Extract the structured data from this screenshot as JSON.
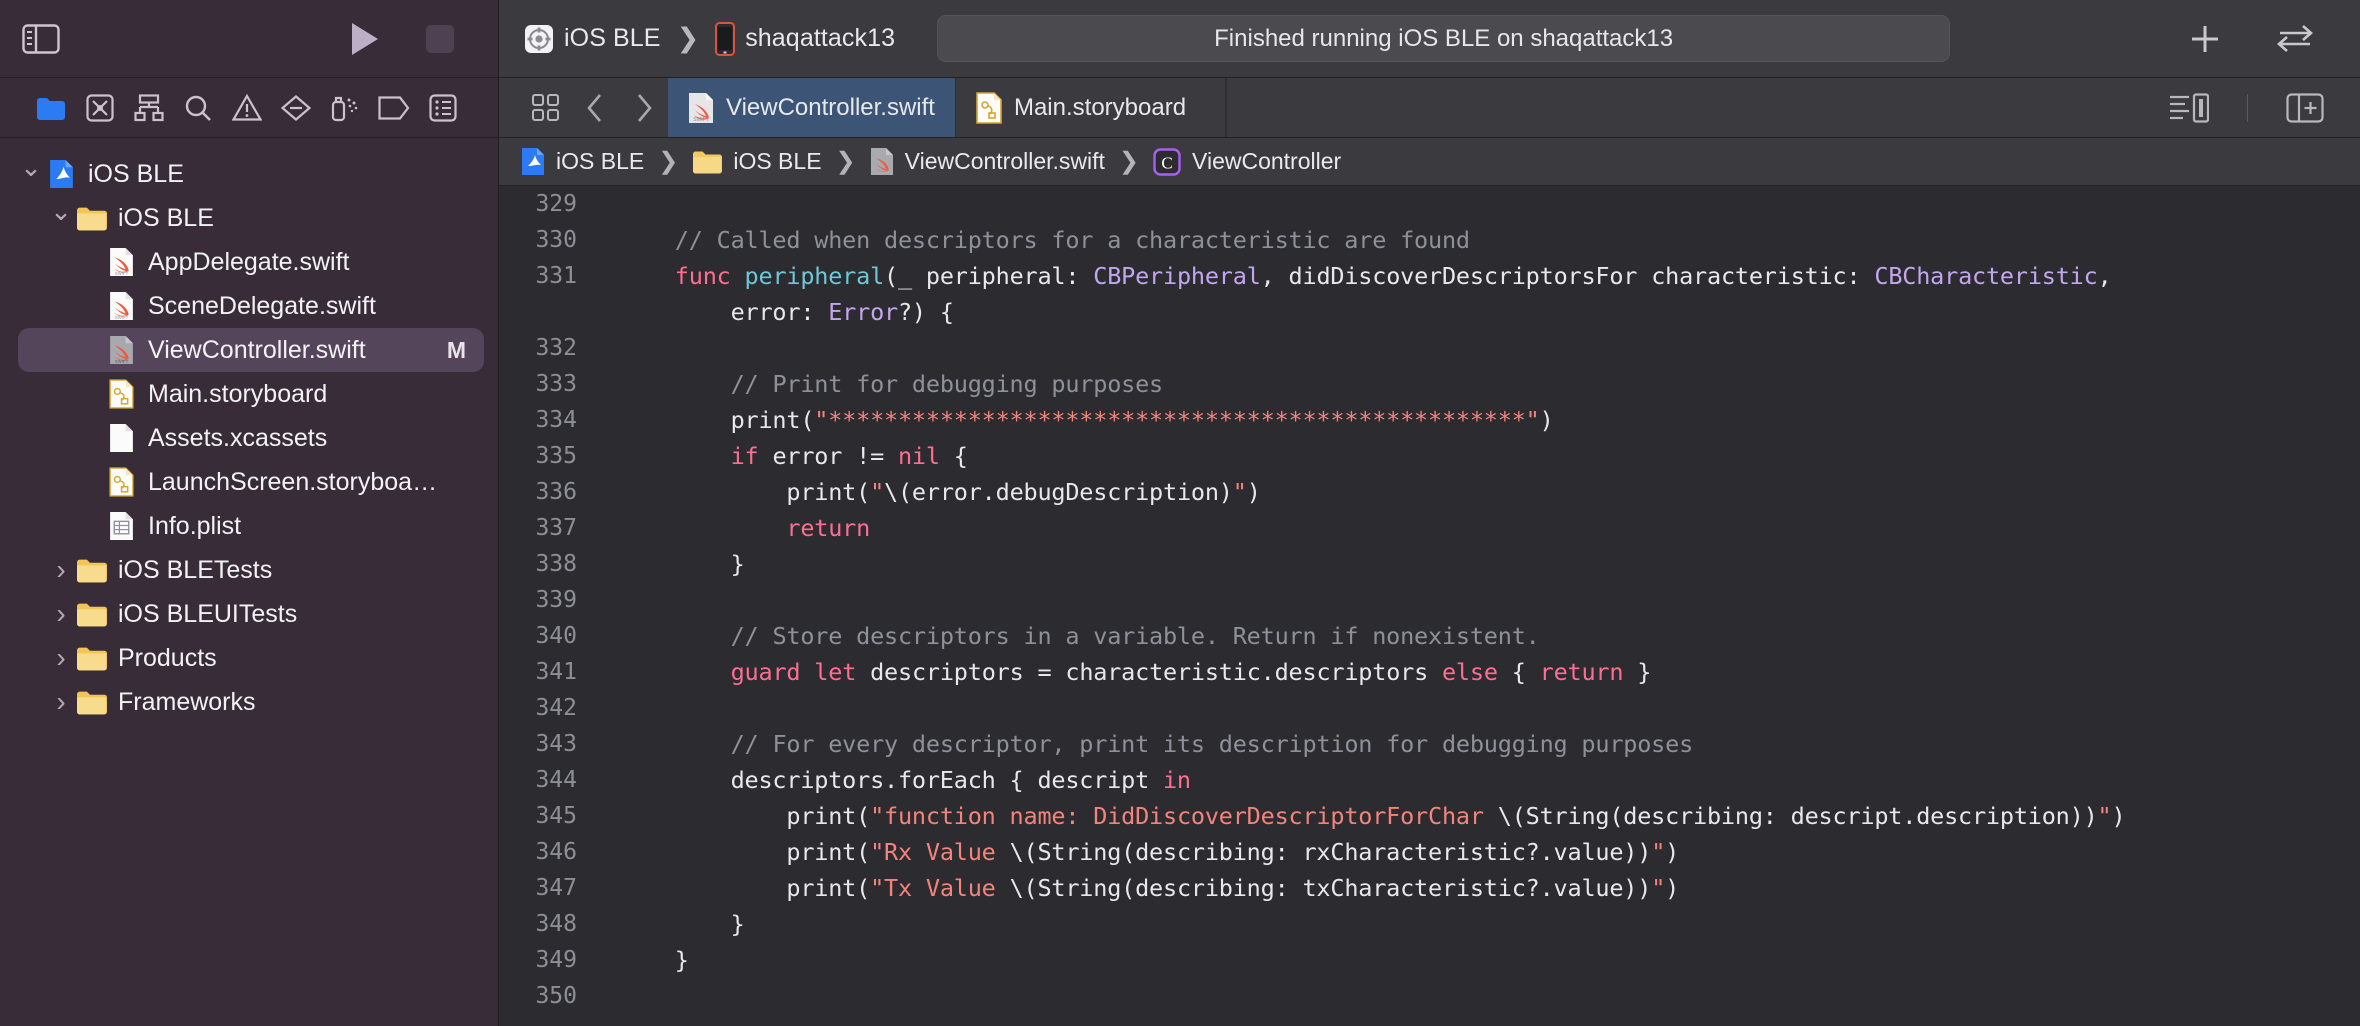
{
  "window": {
    "app": "Xcode",
    "colors": {
      "sidebar_bg": "#382c38",
      "toolbar_bg": "#3b3b3f",
      "editor_bg": "#2c2c30",
      "tab_active_bg": "#3c5577",
      "selection_bg": "#55455a",
      "accent_blue": "#2b7bf3",
      "keyword": "#ff6e91",
      "string": "#f4837b",
      "type": "#c3a6f0",
      "function": "#6ec8d8",
      "comment": "#8f9099"
    }
  },
  "toolbar": {
    "sidebar_toggle_icon": "sidebar-left-icon",
    "run_icon": "play-icon",
    "stop_icon": "stop-icon",
    "scheme": {
      "project_icon": "xcode-scheme-icon",
      "project_label": "iOS BLE",
      "chevron": "❯",
      "device_icon": "iphone-icon",
      "device_label": "shaqattack13"
    },
    "activity_status": "Finished running iOS BLE on shaqattack13",
    "add_icon": "plus-icon",
    "toggle_editor_icon": "left-right-arrows-icon"
  },
  "navigator_icons": [
    {
      "name": "project-navigator-icon",
      "active": true
    },
    {
      "name": "source-control-navigator-icon",
      "active": false
    },
    {
      "name": "hierarchy-navigator-icon",
      "active": false
    },
    {
      "name": "find-navigator-icon",
      "active": false
    },
    {
      "name": "issue-navigator-icon",
      "active": false
    },
    {
      "name": "test-navigator-icon",
      "active": false
    },
    {
      "name": "debug-navigator-icon",
      "active": false
    },
    {
      "name": "breakpoint-navigator-icon",
      "active": false
    },
    {
      "name": "report-navigator-icon",
      "active": false
    }
  ],
  "tabbar": {
    "grid_icon": "tab-grid-icon",
    "back_icon": "chevron-left-icon",
    "forward_icon": "chevron-right-icon",
    "tabs": [
      {
        "label": "ViewController.swift",
        "icon": "swift-file-icon",
        "active": true
      },
      {
        "label": "Main.storyboard",
        "icon": "storyboard-file-icon",
        "active": false
      }
    ],
    "minimap_icon": "minimap-icon",
    "split_editor_icon": "add-editor-icon"
  },
  "breadcrumb": [
    {
      "label": "iOS BLE",
      "icon": "xcode-project-icon"
    },
    {
      "label": "iOS BLE",
      "icon": "folder-icon"
    },
    {
      "label": "ViewController.swift",
      "icon": "swift-file-icon"
    },
    {
      "label": "ViewController",
      "icon": "class-symbol-icon"
    }
  ],
  "breadcrumb_separator": "❯",
  "sidebar": {
    "items": [
      {
        "label": "iOS BLE",
        "icon": "xcode-project-icon",
        "depth": 0,
        "twisty": "down",
        "selected": false,
        "badge": ""
      },
      {
        "label": "iOS BLE",
        "icon": "folder-icon",
        "depth": 1,
        "twisty": "down",
        "selected": false,
        "badge": ""
      },
      {
        "label": "AppDelegate.swift",
        "icon": "swift-file-icon",
        "depth": 2,
        "twisty": "none",
        "selected": false,
        "badge": ""
      },
      {
        "label": "SceneDelegate.swift",
        "icon": "swift-file-icon",
        "depth": 2,
        "twisty": "none",
        "selected": false,
        "badge": ""
      },
      {
        "label": "ViewController.swift",
        "icon": "swift-file-icon-gray",
        "depth": 2,
        "twisty": "none",
        "selected": true,
        "badge": "M"
      },
      {
        "label": "Main.storyboard",
        "icon": "storyboard-file-icon",
        "depth": 2,
        "twisty": "none",
        "selected": false,
        "badge": ""
      },
      {
        "label": "Assets.xcassets",
        "icon": "assets-file-icon",
        "depth": 2,
        "twisty": "none",
        "selected": false,
        "badge": ""
      },
      {
        "label": "LaunchScreen.storyboa…",
        "icon": "storyboard-file-icon",
        "depth": 2,
        "twisty": "none",
        "selected": false,
        "badge": ""
      },
      {
        "label": "Info.plist",
        "icon": "plist-file-icon",
        "depth": 2,
        "twisty": "none",
        "selected": false,
        "badge": ""
      },
      {
        "label": "iOS BLETests",
        "icon": "folder-icon",
        "depth": 1,
        "twisty": "right",
        "selected": false,
        "badge": ""
      },
      {
        "label": "iOS BLEUITests",
        "icon": "folder-icon",
        "depth": 1,
        "twisty": "right",
        "selected": false,
        "badge": ""
      },
      {
        "label": "Products",
        "icon": "folder-icon",
        "depth": 1,
        "twisty": "right",
        "selected": false,
        "badge": ""
      },
      {
        "label": "Frameworks",
        "icon": "folder-icon",
        "depth": 1,
        "twisty": "right",
        "selected": false,
        "badge": ""
      }
    ]
  },
  "code": {
    "language": "Swift",
    "first_visible_line": 329,
    "last_visible_line": 350,
    "lines": [
      {
        "n": 329,
        "tokens": []
      },
      {
        "n": 330,
        "tokens": [
          {
            "t": "    ",
            "c": "pln"
          },
          {
            "t": "// Called when descriptors for a characteristic are found",
            "c": "com"
          }
        ]
      },
      {
        "n": 331,
        "tokens": [
          {
            "t": "    ",
            "c": "pln"
          },
          {
            "t": "func",
            "c": "kw"
          },
          {
            "t": " ",
            "c": "pln"
          },
          {
            "t": "peripheral",
            "c": "fn"
          },
          {
            "t": "(_ peripheral: ",
            "c": "pln"
          },
          {
            "t": "CBPeripheral",
            "c": "ty"
          },
          {
            "t": ", didDiscoverDescriptorsFor characteristic: ",
            "c": "pln"
          },
          {
            "t": "CBCharacteristic",
            "c": "ty"
          },
          {
            "t": ",",
            "c": "pln"
          }
        ]
      },
      {
        "n": 331,
        "cont": true,
        "tokens": [
          {
            "t": "        error: ",
            "c": "pln"
          },
          {
            "t": "Error",
            "c": "ty"
          },
          {
            "t": "?) {",
            "c": "pln"
          }
        ]
      },
      {
        "n": 332,
        "tokens": []
      },
      {
        "n": 333,
        "tokens": [
          {
            "t": "        ",
            "c": "pln"
          },
          {
            "t": "// Print for debugging purposes",
            "c": "com"
          }
        ]
      },
      {
        "n": 334,
        "tokens": [
          {
            "t": "        print(",
            "c": "pln"
          },
          {
            "t": "\"**************************************************\"",
            "c": "str"
          },
          {
            "t": ")",
            "c": "pln"
          }
        ]
      },
      {
        "n": 335,
        "tokens": [
          {
            "t": "        ",
            "c": "pln"
          },
          {
            "t": "if",
            "c": "kw"
          },
          {
            "t": " error != ",
            "c": "pln"
          },
          {
            "t": "nil",
            "c": "kw"
          },
          {
            "t": " {",
            "c": "pln"
          }
        ]
      },
      {
        "n": 336,
        "tokens": [
          {
            "t": "            print(",
            "c": "pln"
          },
          {
            "t": "\"",
            "c": "str"
          },
          {
            "t": "\\(error.debugDescription)",
            "c": "pln"
          },
          {
            "t": "\"",
            "c": "str"
          },
          {
            "t": ")",
            "c": "pln"
          }
        ]
      },
      {
        "n": 337,
        "tokens": [
          {
            "t": "            ",
            "c": "pln"
          },
          {
            "t": "return",
            "c": "kw"
          }
        ]
      },
      {
        "n": 338,
        "tokens": [
          {
            "t": "        }",
            "c": "pln"
          }
        ]
      },
      {
        "n": 339,
        "tokens": []
      },
      {
        "n": 340,
        "tokens": [
          {
            "t": "        ",
            "c": "pln"
          },
          {
            "t": "// Store descriptors in a variable. Return if nonexistent.",
            "c": "com"
          }
        ]
      },
      {
        "n": 341,
        "tokens": [
          {
            "t": "        ",
            "c": "pln"
          },
          {
            "t": "guard",
            "c": "kw"
          },
          {
            "t": " ",
            "c": "pln"
          },
          {
            "t": "let",
            "c": "kw"
          },
          {
            "t": " descriptors = characteristic.descriptors ",
            "c": "pln"
          },
          {
            "t": "else",
            "c": "kw"
          },
          {
            "t": " { ",
            "c": "pln"
          },
          {
            "t": "return",
            "c": "kw"
          },
          {
            "t": " }",
            "c": "pln"
          }
        ]
      },
      {
        "n": 342,
        "tokens": []
      },
      {
        "n": 343,
        "tokens": [
          {
            "t": "        ",
            "c": "pln"
          },
          {
            "t": "// For every descriptor, print its description for debugging purposes",
            "c": "com"
          }
        ]
      },
      {
        "n": 344,
        "tokens": [
          {
            "t": "        descriptors.forEach { descript ",
            "c": "pln"
          },
          {
            "t": "in",
            "c": "kw"
          }
        ]
      },
      {
        "n": 345,
        "tokens": [
          {
            "t": "            print(",
            "c": "pln"
          },
          {
            "t": "\"function name: DidDiscoverDescriptorForChar ",
            "c": "str"
          },
          {
            "t": "\\(String(describing: descript.description))",
            "c": "pln"
          },
          {
            "t": "\"",
            "c": "str"
          },
          {
            "t": ")",
            "c": "pln"
          }
        ]
      },
      {
        "n": 346,
        "tokens": [
          {
            "t": "            print(",
            "c": "pln"
          },
          {
            "t": "\"Rx Value ",
            "c": "str"
          },
          {
            "t": "\\(String(describing: rxCharacteristic?.value))",
            "c": "pln"
          },
          {
            "t": "\"",
            "c": "str"
          },
          {
            "t": ")",
            "c": "pln"
          }
        ]
      },
      {
        "n": 347,
        "tokens": [
          {
            "t": "            print(",
            "c": "pln"
          },
          {
            "t": "\"Tx Value ",
            "c": "str"
          },
          {
            "t": "\\(String(describing: txCharacteristic?.value))",
            "c": "pln"
          },
          {
            "t": "\"",
            "c": "str"
          },
          {
            "t": ")",
            "c": "pln"
          }
        ]
      },
      {
        "n": 348,
        "tokens": [
          {
            "t": "        }",
            "c": "pln"
          }
        ]
      },
      {
        "n": 349,
        "tokens": [
          {
            "t": "    }",
            "c": "pln"
          }
        ]
      },
      {
        "n": 350,
        "tokens": []
      }
    ]
  }
}
